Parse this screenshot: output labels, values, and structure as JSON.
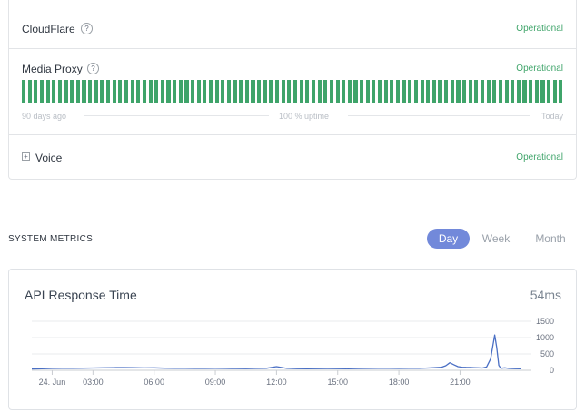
{
  "components": [
    {
      "name": "CloudFlare",
      "has_help": true,
      "status": "Operational"
    },
    {
      "name": "Media Proxy",
      "has_help": true,
      "status": "Operational",
      "uptime": {
        "start_label": "90 days ago",
        "center_label": "100 % uptime",
        "end_label": "Today",
        "bar_count": 90,
        "bar_color": "#3fa46a"
      }
    },
    {
      "name": "Voice",
      "expandable": true,
      "status": "Operational"
    }
  ],
  "icons": {
    "help": "question-circle-icon",
    "expand": "plus-square-icon"
  },
  "status_color": "#3fa46a",
  "metrics": {
    "section_title": "SYSTEM METRICS",
    "ranges": [
      "Day",
      "Week",
      "Month"
    ],
    "selected_range": "Day",
    "accent": "#7289da"
  },
  "api_response": {
    "title": "API Response Time",
    "current_value": "54ms",
    "chart_data": {
      "type": "line",
      "series": [
        {
          "name": "",
          "color": "#4a6fc4"
        }
      ],
      "x": [
        0.0,
        0.5,
        1.0,
        1.5,
        2.0,
        2.5,
        3.0,
        3.5,
        4.0,
        4.5,
        5.0,
        5.5,
        6.0,
        6.5,
        7.0,
        7.5,
        8.0,
        8.5,
        9.0,
        9.5,
        10.0,
        10.5,
        11.0,
        11.5,
        12.0,
        12.5,
        13.0,
        13.5,
        14.0,
        14.5,
        15.0,
        15.5,
        16.0,
        16.5,
        17.0,
        17.5,
        18.0,
        18.5,
        19.0,
        19.3,
        19.6,
        19.9,
        20.1,
        20.3,
        20.5,
        20.7,
        20.9,
        21.1,
        21.3,
        21.5,
        21.7,
        21.9,
        22.1,
        22.3,
        22.5,
        22.7,
        22.8,
        22.9,
        23.0,
        23.2,
        23.4,
        23.7,
        24.0
      ],
      "values": [
        40,
        45,
        55,
        60,
        62,
        65,
        70,
        75,
        80,
        82,
        78,
        72,
        75,
        65,
        60,
        58,
        55,
        56,
        58,
        55,
        52,
        50,
        55,
        60,
        110,
        58,
        50,
        48,
        50,
        52,
        50,
        48,
        52,
        55,
        60,
        58,
        55,
        58,
        62,
        68,
        75,
        85,
        95,
        140,
        230,
        170,
        110,
        95,
        90,
        85,
        80,
        75,
        70,
        100,
        350,
        1080,
        700,
        150,
        60,
        75,
        55,
        50,
        48
      ],
      "x_ticks": [
        {
          "x": 1.0,
          "label": "24. Jun"
        },
        {
          "x": 3.0,
          "label": "03:00"
        },
        {
          "x": 6.0,
          "label": "06:00"
        },
        {
          "x": 9.0,
          "label": "09:00"
        },
        {
          "x": 12.0,
          "label": "12:00"
        },
        {
          "x": 15.0,
          "label": "15:00"
        },
        {
          "x": 18.0,
          "label": "18:00"
        },
        {
          "x": 21.0,
          "label": "21:00"
        }
      ],
      "y_ticks": [
        0,
        500,
        1000,
        1500
      ],
      "xlim": [
        0,
        24.5
      ],
      "ylim": [
        0,
        1500
      ],
      "grid": true
    }
  }
}
